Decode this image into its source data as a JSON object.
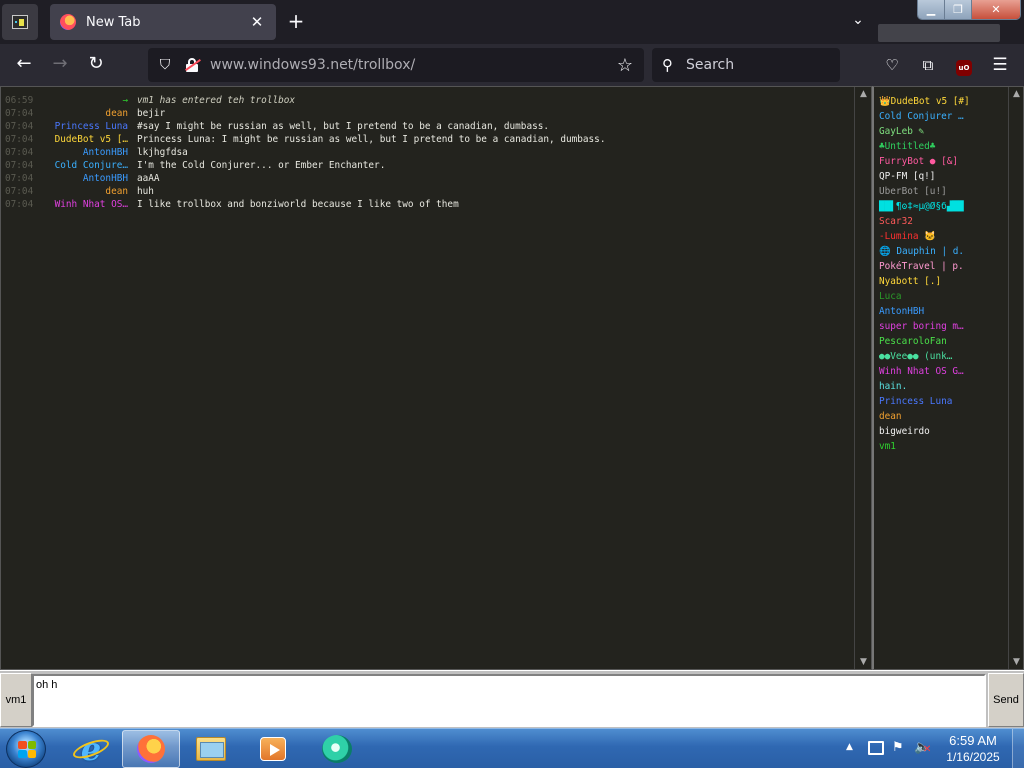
{
  "browser": {
    "tab_title": "New Tab",
    "url_host": "www.windows93.net",
    "url_path": "/trollbox/",
    "search_placeholder": "Search",
    "icons": [
      "app-icon",
      "firefox-icon",
      "close-icon",
      "plus-icon",
      "chevron-down-icon",
      "back-arrow-icon",
      "forward-arrow-icon",
      "reload-icon",
      "shield-icon",
      "lock-icon",
      "star-icon",
      "search-icon",
      "pocket-icon",
      "extensions-icon",
      "ublock-icon",
      "hamburger-menu-icon"
    ]
  },
  "trollbox": {
    "messages": [
      {
        "time": "06:59",
        "nick": "→",
        "text": "vm1 has entered teh trollbox",
        "color": "#2fd02f",
        "system": true
      },
      {
        "time": "07:04",
        "nick": "dean",
        "text": "bejir",
        "color": "#f0a030"
      },
      {
        "time": "07:04",
        "nick": "Princess Luna",
        "text": "#say I might be russian as well, but I pretend to be a canadian, dumbass.",
        "color": "#4a78ff"
      },
      {
        "time": "07:04",
        "nick": "DudeBot v5 […",
        "text": "Princess Luna: I might be russian as well, but I pretend to be a canadian, dumbass.",
        "color": "#ffd83a"
      },
      {
        "time": "07:04",
        "nick": "AntonHBH",
        "text": "lkjhgfdsa",
        "color": "#3a9bff"
      },
      {
        "time": "07:04",
        "nick": "Cold Conjure…",
        "text": "I'm the Cold Conjurer... or Ember Enchanter.",
        "color": "#3ab0ff"
      },
      {
        "time": "07:04",
        "nick": "AntonHBH",
        "text": "aaAA",
        "color": "#3a9bff"
      },
      {
        "time": "07:04",
        "nick": "dean",
        "text": "huh",
        "color": "#f0a030"
      },
      {
        "time": "07:04",
        "nick": "Winh Nhat OS…",
        "text": "I like trollbox and bonziworld because I like two of them",
        "color": "#e040e0"
      }
    ],
    "users": [
      {
        "name": "👑DudeBot v5 [#]",
        "color": "#ffd83a"
      },
      {
        "name": "Cold Conjurer …",
        "color": "#3ab0ff"
      },
      {
        "name": "GayLeb ✎",
        "color": "#7fe07f"
      },
      {
        "name": "♣Untitled♣",
        "color": "#2fd05f"
      },
      {
        "name": "FurryBot ● [&]",
        "color": "#ff5aa0"
      },
      {
        "name": "QP-FM [q!]",
        "color": "#f0f0f0"
      },
      {
        "name": "UberBot [u!]",
        "color": "#9a9a9a"
      },
      {
        "name": "██▌¶ʘ‡≈µ@Ø§б▟██",
        "color": "#00e0e0"
      },
      {
        "name": "Scar32",
        "color": "#ff5a5a"
      },
      {
        "name": "-Lumina 🐱",
        "color": "#ff3030"
      },
      {
        "name": "🌐 Dauphin | d.",
        "color": "#3ab0ff"
      },
      {
        "name": "PokéTravel | p.",
        "color": "#ff9ad0"
      },
      {
        "name": "Nyabott [.]",
        "color": "#ffd83a"
      },
      {
        "name": "Luca",
        "color": "#2a9a2a"
      },
      {
        "name": "AntonHBH",
        "color": "#3a9bff"
      },
      {
        "name": "super boring m…",
        "color": "#e040e0"
      },
      {
        "name": "PescaroloFan",
        "color": "#4ae04a"
      },
      {
        "name": "●●Vee●● (unk…",
        "color": "#4ae0a0"
      },
      {
        "name": "Winh Nhat OS G…",
        "color": "#e040e0"
      },
      {
        "name": "hain.",
        "color": "#5ae0e0"
      },
      {
        "name": "Princess Luna",
        "color": "#4a78ff"
      },
      {
        "name": "dean",
        "color": "#f0a030"
      },
      {
        "name": "bigweirdo",
        "color": "#f0f0f0"
      },
      {
        "name": "vm1",
        "color": "#2fd02f"
      }
    ],
    "nick_button": "vm1",
    "input_value": "oh h",
    "send_label": "Send"
  },
  "taskbar": {
    "apps": [
      "windows-start-icon",
      "internet-explorer-icon",
      "firefox-icon",
      "file-explorer-icon",
      "media-player-icon",
      "app-icon"
    ],
    "tray_arrow": "▲",
    "time": "6:59 AM",
    "date": "1/16/2025"
  }
}
